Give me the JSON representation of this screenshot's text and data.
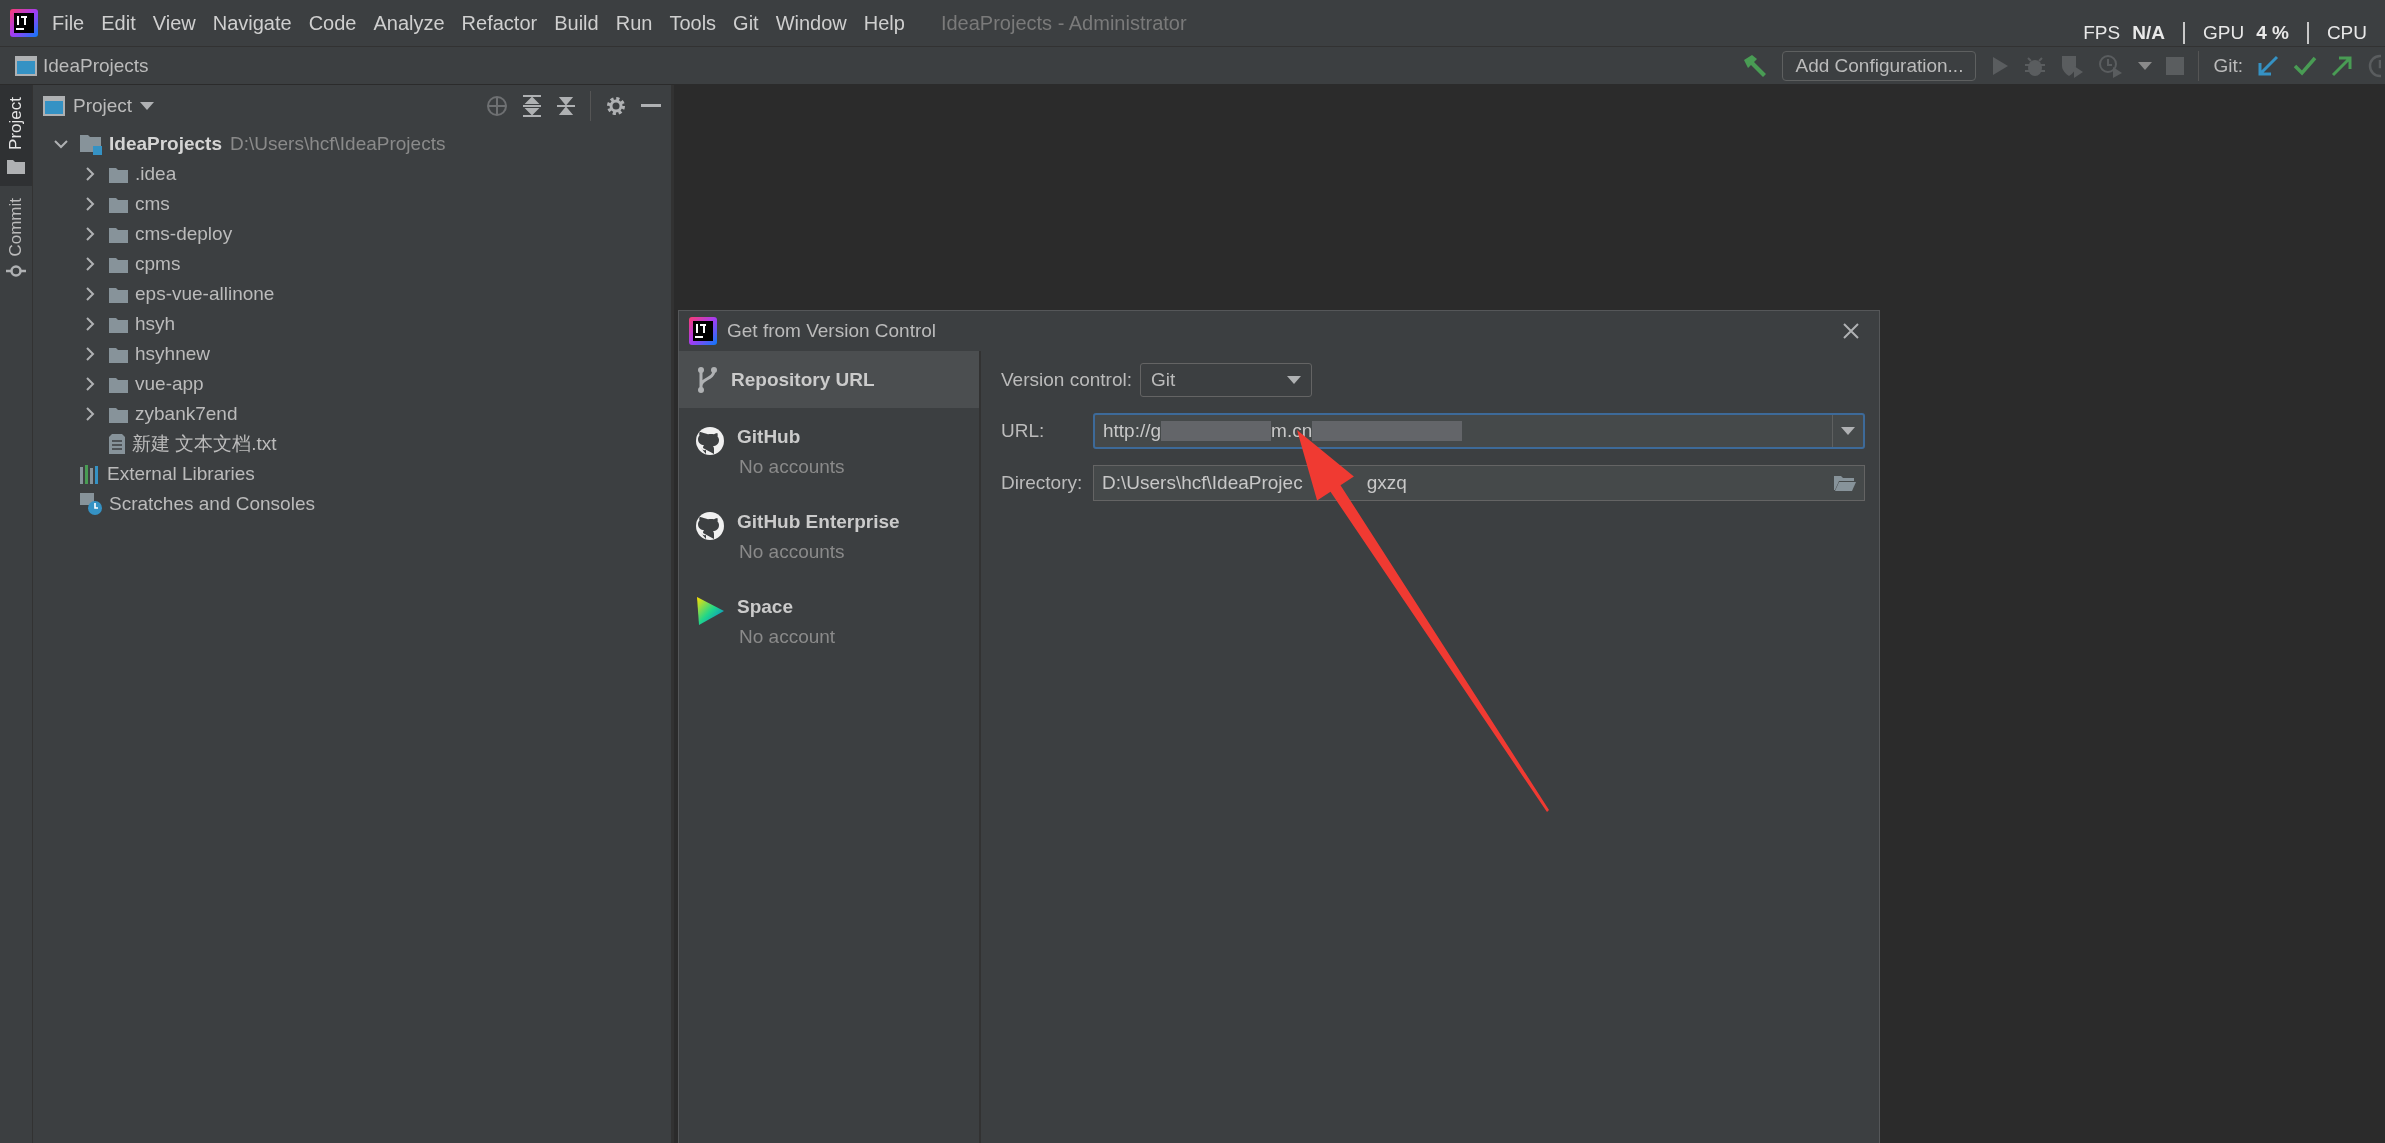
{
  "menu_bar": {
    "items": [
      {
        "label": "File"
      },
      {
        "label": "Edit"
      },
      {
        "label": "View"
      },
      {
        "label": "Navigate"
      },
      {
        "label": "Code"
      },
      {
        "label": "Analyze"
      },
      {
        "label": "Refactor"
      },
      {
        "label": "Build"
      },
      {
        "label": "Run"
      },
      {
        "label": "Tools"
      },
      {
        "label": "Git"
      },
      {
        "label": "Window"
      },
      {
        "label": "Help"
      }
    ],
    "window_title": "IdeaProjects - Administrator"
  },
  "overlay_stats": [
    {
      "label": "FPS",
      "value": "N/A"
    },
    {
      "label": "GPU",
      "value": "4 %"
    },
    {
      "label": "CPU"
    }
  ],
  "nav_bar": {
    "breadcrumb": "IdeaProjects",
    "run_config": "Add Configuration...",
    "git_label": "Git:"
  },
  "tool_stripe": [
    {
      "label": "Project",
      "kind": "project",
      "selected": true
    },
    {
      "label": "Commit",
      "kind": "commit",
      "selected": false
    }
  ],
  "project_panel": {
    "title": "Project",
    "tree": [
      {
        "label": "IdeaProjects",
        "path": "D:\\Users\\hcf\\IdeaProjects",
        "kind": "module",
        "expanded": true,
        "children": [
          {
            "label": ".idea",
            "kind": "folder",
            "expanded": false
          },
          {
            "label": "cms",
            "kind": "folder",
            "expanded": false
          },
          {
            "label": "cms-deploy",
            "kind": "folder",
            "expanded": false
          },
          {
            "label": "cpms",
            "kind": "folder",
            "expanded": false
          },
          {
            "label": "eps-vue-allinone",
            "kind": "folder",
            "expanded": false
          },
          {
            "label": "hsyh",
            "kind": "folder",
            "expanded": false
          },
          {
            "label": "hsyhnew",
            "kind": "folder",
            "expanded": false
          },
          {
            "label": "vue-app",
            "kind": "folder",
            "expanded": false
          },
          {
            "label": "zybank7end",
            "kind": "folder",
            "expanded": false
          },
          {
            "label": "新建 文本文档.txt",
            "kind": "file"
          }
        ]
      },
      {
        "label": "External Libraries",
        "kind": "libraries"
      },
      {
        "label": "Scratches and Consoles",
        "kind": "scratches"
      }
    ]
  },
  "dialog": {
    "title": "Get from Version Control",
    "sources": [
      {
        "kind": "repository",
        "label": "Repository URL",
        "selected": true
      },
      {
        "kind": "github",
        "label": "GitHub",
        "note": "No accounts",
        "selected": false
      },
      {
        "kind": "github",
        "label": "GitHub Enterprise",
        "note": "No accounts",
        "selected": false
      },
      {
        "kind": "space",
        "label": "Space",
        "note": "No account",
        "selected": false
      }
    ],
    "form": {
      "version_control_label": "Version control:",
      "version_control": "Git",
      "url_label": "URL:",
      "url_start": "http://g",
      "url_middle": "m.cn",
      "directory_label": "Directory:",
      "directory_start": "D:\\Users\\hcf\\IdeaProjec",
      "directory_end": "gxzq"
    }
  }
}
